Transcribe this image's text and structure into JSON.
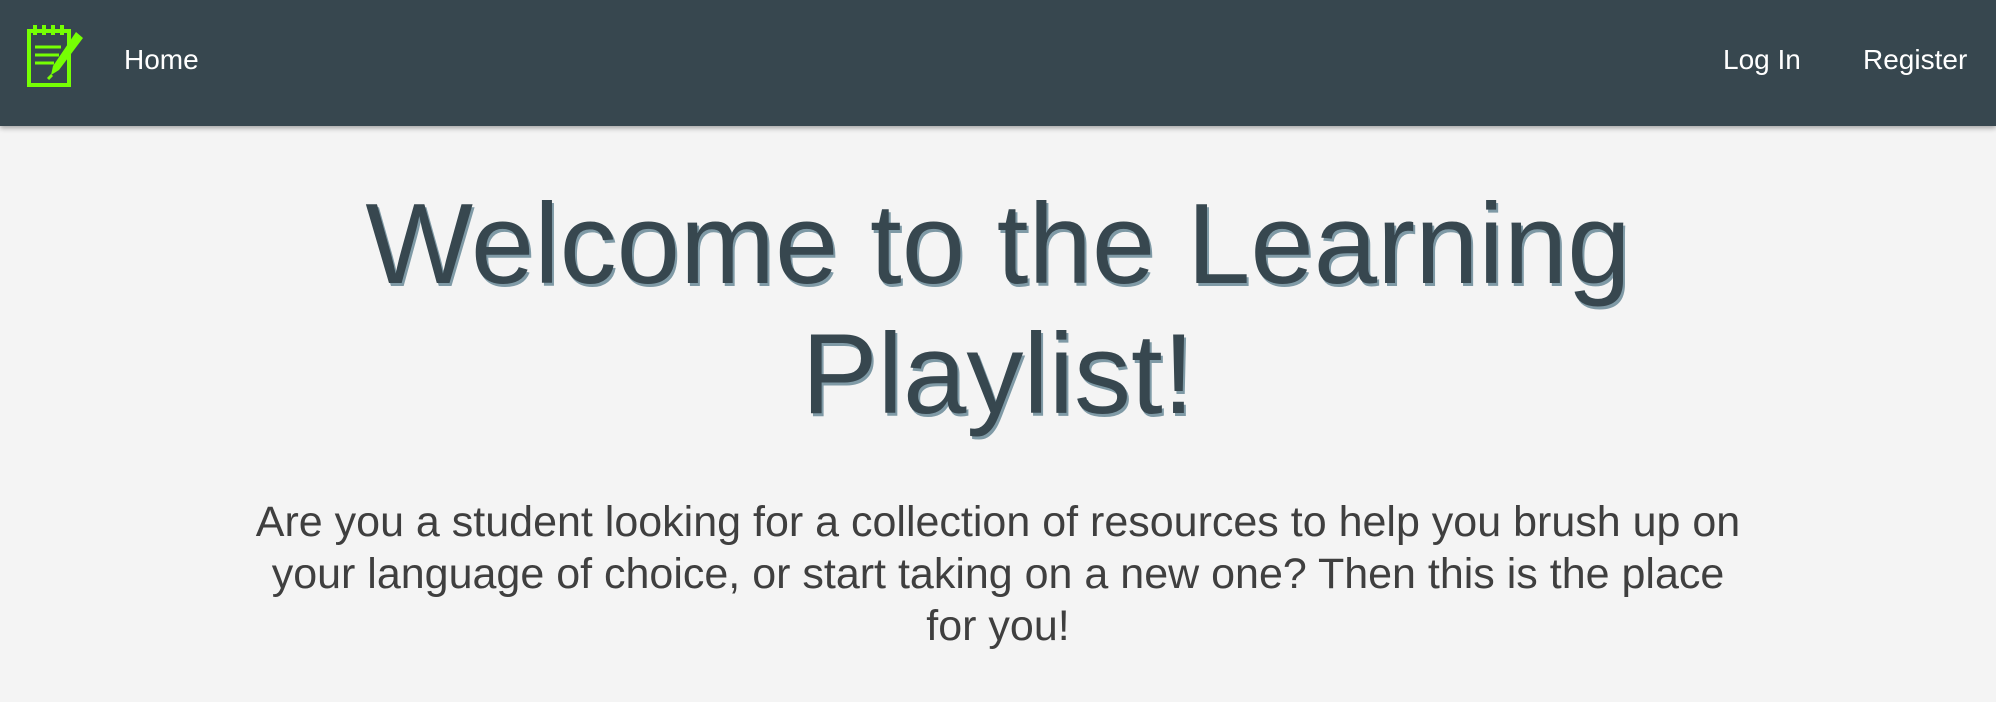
{
  "colors": {
    "navbar_background": "#37474f",
    "page_background": "#f4f4f4",
    "logo_accent": "#76ff03",
    "title_color": "#37474f",
    "body_text": "#3f3f3f"
  },
  "navbar": {
    "logo_icon": "notepad-pencil-icon",
    "home_label": "Home",
    "login_label": "Log In",
    "register_label": "Register"
  },
  "hero": {
    "title": "Welcome to the Learning Playlist!",
    "description": "Are you a student looking for a collection of resources to help you brush up on your language of choice, or start taking on a new one? Then this is the place for you!"
  }
}
